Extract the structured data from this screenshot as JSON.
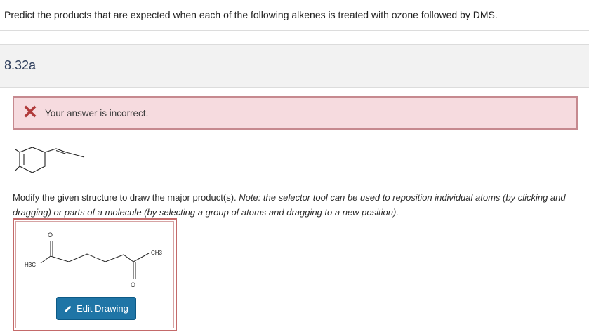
{
  "question": {
    "text": "Predict the products that are expected when each of the following alkenes is treated with ozone followed by DMS."
  },
  "part": {
    "label": "8.32a"
  },
  "feedback": {
    "icon": "x-mark-icon",
    "message": "Your answer is incorrect.",
    "color": "#b03a3a",
    "background": "#f6dbdf"
  },
  "instructions": {
    "plain": "Modify the given structure to draw the major product(s). ",
    "note_italic": "Note: the selector tool can be used to reposition individual atoms (by clicking and dragging) or parts of a molecule (by selecting a group of atoms and dragging to a new position)."
  },
  "product": {
    "atoms": {
      "o_top": "O",
      "o_bottom": "O",
      "h3c": "H3C",
      "ch3": "CH3"
    }
  },
  "edit_button": {
    "label": "Edit Drawing",
    "icon": "pencil-icon",
    "color": "#1f75a6"
  }
}
